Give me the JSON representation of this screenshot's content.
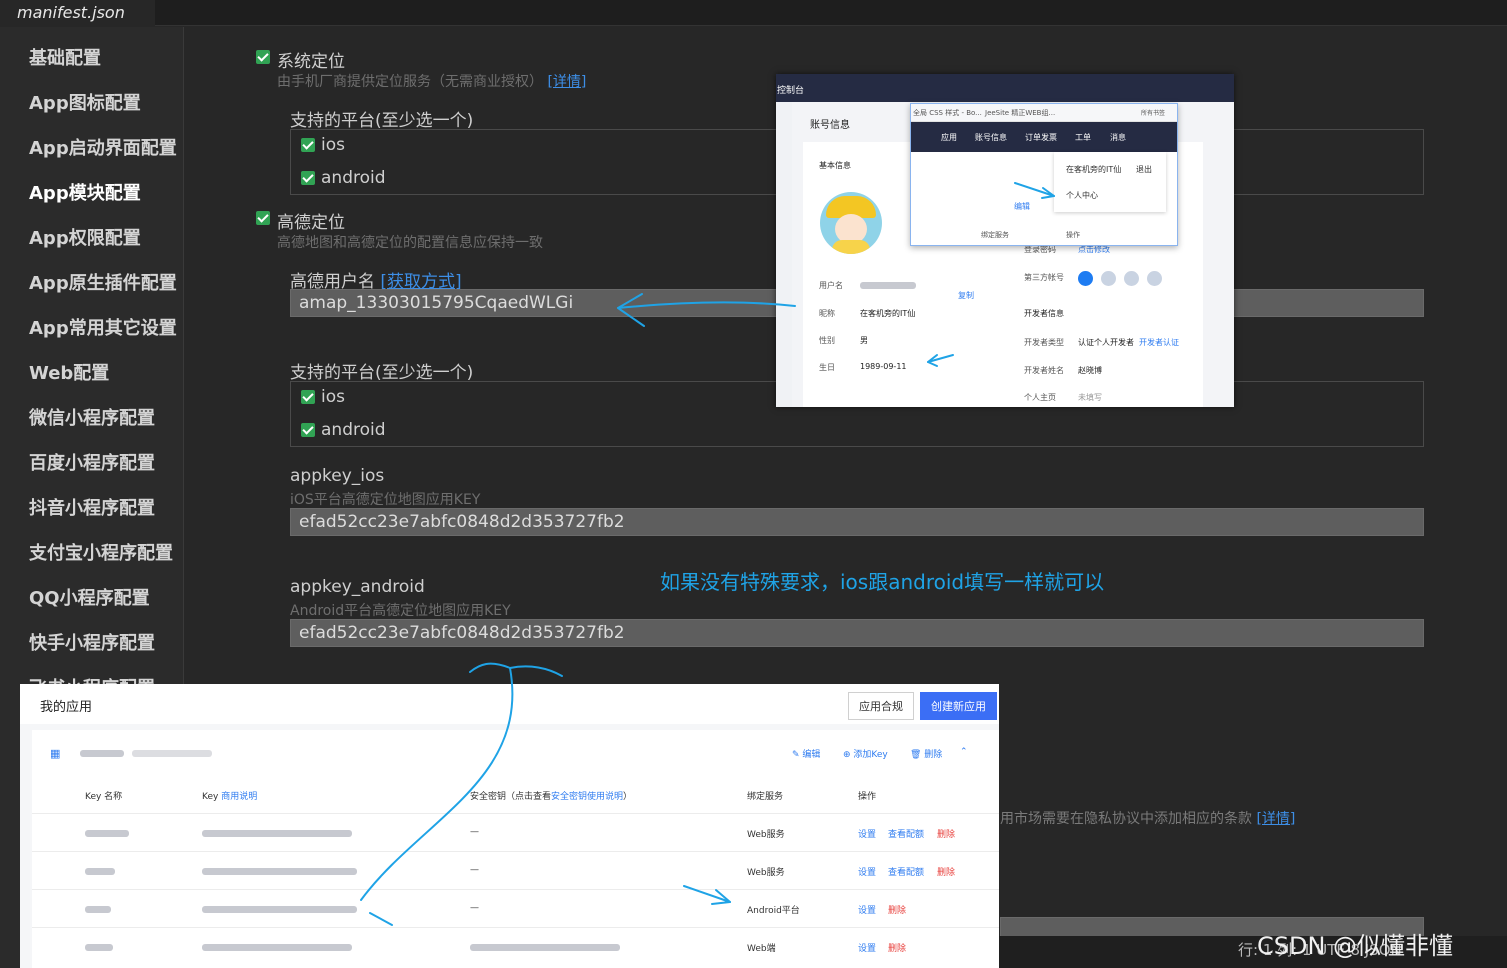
{
  "tab": {
    "title": "manifest.json"
  },
  "sidebar": {
    "items": [
      "基础配置",
      "App图标配置",
      "App启动界面配置",
      "App模块配置",
      "App权限配置",
      "App原生插件配置",
      "App常用其它设置",
      "Web配置",
      "微信小程序配置",
      "百度小程序配置",
      "抖音小程序配置",
      "支付宝小程序配置",
      "QQ小程序配置",
      "快手小程序配置",
      "飞书小程序配置"
    ],
    "active": "App模块配置"
  },
  "main": {
    "system_location": {
      "label": "系统定位",
      "desc": "由手机厂商提供定位服务（无需商业授权）",
      "link": "[详情]"
    },
    "platforms1": {
      "title": "支持的平台(至少选一个)",
      "ios": "ios",
      "android": "android"
    },
    "amap": {
      "label": "高德定位",
      "desc": "高德地图和高德定位的配置信息应保持一致"
    },
    "amap_user": {
      "label": "高德用户名",
      "link": "[获取方式]",
      "value": "amap_13303015795CqaedWLGi"
    },
    "platforms2": {
      "title": "支持的平台(至少选一个)",
      "ios": "ios",
      "android": "android"
    },
    "appkey_ios": {
      "label": "appkey_ios",
      "desc": "iOS平台高德定位地图应用KEY",
      "value": "efad52cc23e7abfc0848d2d353727fb2"
    },
    "appkey_android": {
      "label": "appkey_android",
      "desc": "Android平台高德定位地图应用KEY",
      "value": "efad52cc23e7abfc0848d2d353727fb2"
    },
    "note": "如果没有特殊要求，ios跟android填写一样就可以",
    "privacy_hint": "用市场需要在隐私协议中添加相应的条款",
    "privacy_link": "[详情]"
  },
  "account_overlay": {
    "header": "控制台",
    "section": "账号信息",
    "basic": "基本信息",
    "fields": {
      "username": "用户名",
      "copy": "复制",
      "nickname": "昵称",
      "nickname_value": "在客机旁的IT仙",
      "gender": "性别",
      "gender_value": "男",
      "birthday": "生日",
      "birthday_value": "1989-09-11"
    },
    "right": {
      "login_pwd": "登录密码",
      "modify": "点击修改",
      "third": "第三方帐号",
      "dev_info": "开发者信息",
      "dev_type": "开发者类型",
      "dev_type_value": "认证个人开发者",
      "dev_cert": "开发者认证",
      "dev_name": "开发者姓名",
      "dev_name_value": "赵晓博",
      "home": "个人主页",
      "home_value": "未填写"
    },
    "browser": {
      "bookmark1": "全局 CSS 样式 - Bo...",
      "bookmark2": "JeeSite 精正WEB组...",
      "bookmark3": "所有书签",
      "nav": [
        "应用",
        "账号信息",
        "订单发票",
        "工单",
        "消息"
      ],
      "dropdown_user": "在客机旁的IT仙",
      "logout": "退出",
      "personal_center": "个人中心",
      "edit": "编辑",
      "bind": "绑定服务",
      "ops": "操作"
    }
  },
  "apps_overlay": {
    "title": "我的应用",
    "btn_compliance": "应用合规",
    "btn_create": "创建新应用",
    "actions": {
      "edit": "编辑",
      "add_key": "添加Key",
      "delete": "删除"
    },
    "columns": [
      "Key 名称",
      "Key",
      "商用说明",
      "安全密钥（点击查看",
      "安全密钥使用说明",
      "）",
      "绑定服务",
      "操作"
    ],
    "rows": [
      {
        "service": "Web服务",
        "sec": "—",
        "ops": [
          "设置",
          "查看配额",
          "删除"
        ]
      },
      {
        "service": "Web服务",
        "sec": "—",
        "ops": [
          "设置",
          "查看配额",
          "删除"
        ]
      },
      {
        "service": "Android平台",
        "sec": "—",
        "ops": [
          "设置",
          "删除"
        ]
      },
      {
        "service": "Web端",
        "sec": "",
        "ops": [
          "设置",
          "删除"
        ]
      }
    ]
  },
  "watermark": "CSDN @似懂非懂",
  "status": "行: 1 列: 1   UTF-8   JSON"
}
